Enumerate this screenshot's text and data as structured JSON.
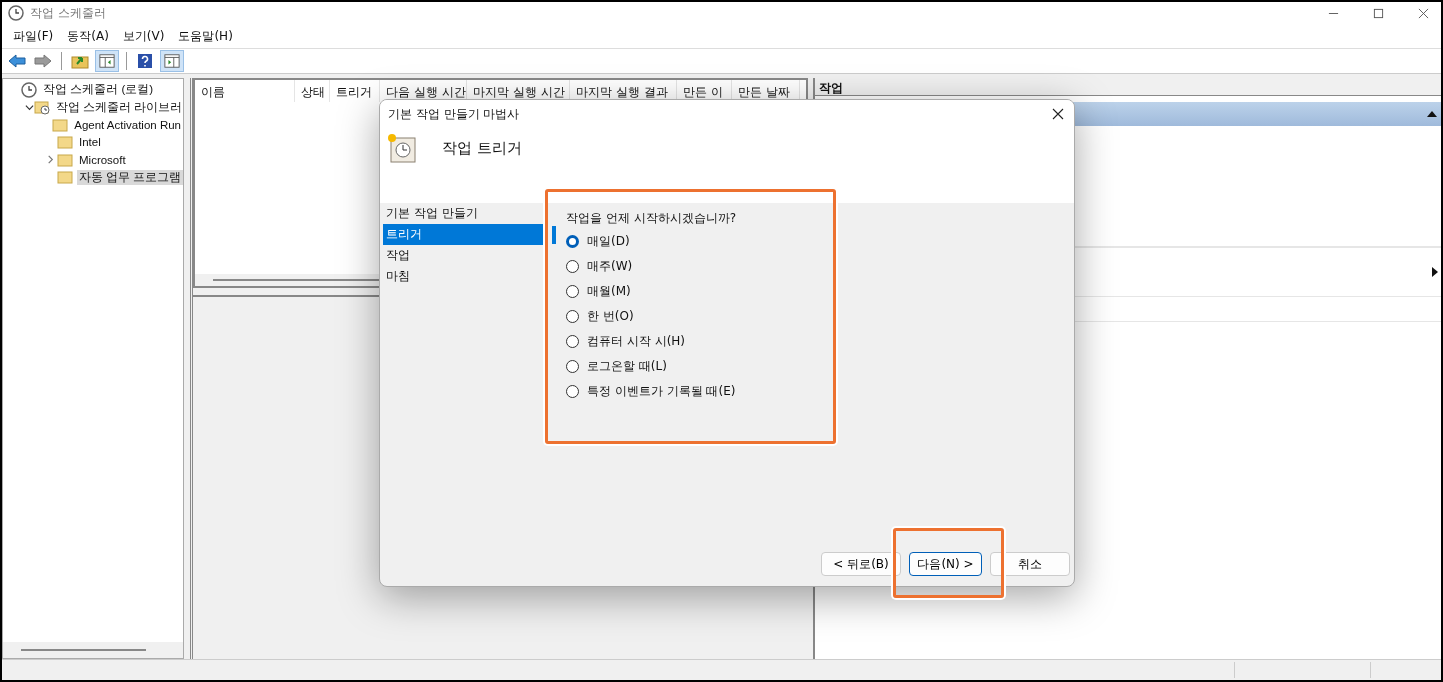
{
  "window": {
    "title": "작업 스케줄러"
  },
  "menu": [
    "파일(F)",
    "동작(A)",
    "보기(V)",
    "도움말(H)"
  ],
  "tree": [
    {
      "label": "작업 스케줄러 (로컬)",
      "kind": "root",
      "selected": false,
      "children": [
        {
          "label": "작업 스케줄러 라이브러",
          "kind": "branch",
          "expanded": true,
          "selected": false,
          "children": [
            {
              "label": "Agent Activation Run",
              "kind": "leaf",
              "selected": false
            },
            {
              "label": "Intel",
              "kind": "leaf",
              "selected": false
            },
            {
              "label": "Microsoft",
              "kind": "branch",
              "expanded": false,
              "selected": false
            },
            {
              "label": "자동 업무 프로그램",
              "kind": "leaf",
              "selected": true
            }
          ]
        }
      ]
    }
  ],
  "table": {
    "columns": [
      "이름",
      "상태",
      "트리거",
      "다음 실행 시간",
      "마지막 실행 시간",
      "마지막 실행 결과",
      "만든 이",
      "만든 날짜"
    ]
  },
  "actions_panel": {
    "title": "작업"
  },
  "dialog": {
    "title": "기본 작업 만들기 마법사",
    "heading": "작업 트리거",
    "steps": [
      {
        "label": "기본 작업 만들기",
        "selected": false
      },
      {
        "label": "트리거",
        "selected": true
      },
      {
        "label": "작업",
        "selected": false
      },
      {
        "label": "마침",
        "selected": false
      }
    ],
    "question": "작업을 언제 시작하시겠습니까?",
    "options": [
      {
        "label": "매일(D)",
        "selected": true
      },
      {
        "label": "매주(W)",
        "selected": false
      },
      {
        "label": "매월(M)",
        "selected": false
      },
      {
        "label": "한 번(O)",
        "selected": false
      },
      {
        "label": "컴퓨터 시작 시(H)",
        "selected": false
      },
      {
        "label": "로그온할 때(L)",
        "selected": false
      },
      {
        "label": "특정 이벤트가 기록될 때(E)",
        "selected": false
      }
    ],
    "buttons": [
      "< 뒤로(B)",
      "다음(N) >",
      "취소"
    ]
  }
}
